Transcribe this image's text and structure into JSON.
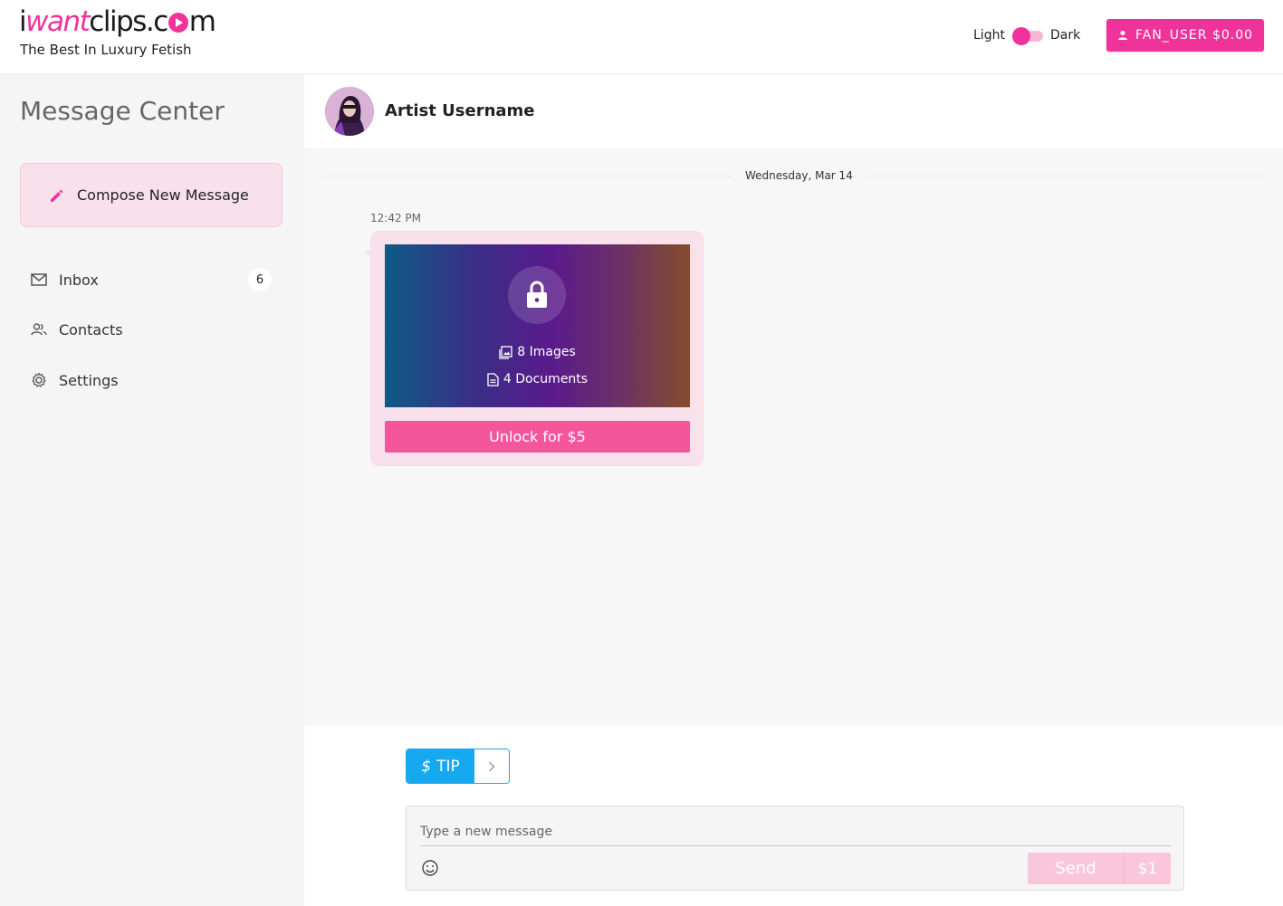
{
  "header": {
    "logo_parts": [
      "i",
      "want",
      "clips.c",
      "m"
    ],
    "tagline": "The Best In Luxury Fetish",
    "theme_light": "Light",
    "theme_dark": "Dark",
    "user_button_label": "FAN_USER $0.00"
  },
  "sidebar": {
    "title": "Message Center",
    "compose_label": "Compose New Message",
    "items": [
      {
        "label": "Inbox",
        "icon": "mail-icon",
        "badge": "6"
      },
      {
        "label": "Contacts",
        "icon": "contacts-icon"
      },
      {
        "label": "Settings",
        "icon": "gear-icon"
      }
    ]
  },
  "chat": {
    "artist_name": "Artist Username",
    "date_label": "Wednesday, Mar 14",
    "message": {
      "time": "12:42 PM",
      "images_label": "8 Images",
      "documents_label": "4 Documents",
      "unlock_label": "Unlock for $5"
    }
  },
  "composer": {
    "tip_label": "TIP",
    "tip_symbol": "$",
    "placeholder": "Type a new message",
    "send_label": "Send",
    "send_price": "$1"
  },
  "colors": {
    "brand_pink": "#f0339a",
    "tip_blue": "#16a9ef",
    "compose_bg": "#f9e1ec"
  }
}
